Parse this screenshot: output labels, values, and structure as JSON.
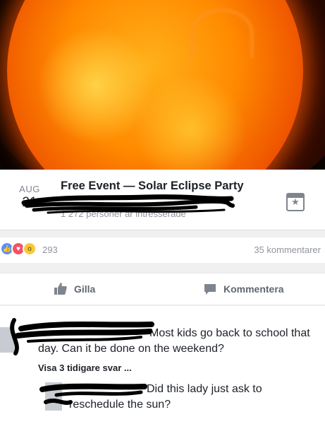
{
  "event": {
    "month": "AUG",
    "day": "21",
    "title": "Free Event — Solar Eclipse Party",
    "subtitle": "1 272 personer är intresserade"
  },
  "stats": {
    "reaction_count": "293",
    "comment_count": "35 kommentarer",
    "reactions": [
      "like-icon",
      "love-icon",
      "wow-icon"
    ]
  },
  "actions": {
    "like_label": "Gilla",
    "comment_label": "Kommentera"
  },
  "comments": {
    "first_text": "Most kids go back to school that day. Can it be done on the weekend?",
    "view_replies": "Visa 3 tidigare svar ...",
    "reply_text": "Did this lady just ask to reschedule the sun?"
  },
  "colors": {
    "like_blue": "#5890ff",
    "love_red": "#f25268",
    "wow_yellow": "#f7c93a",
    "muted_text": "#90949c",
    "sun_orange": "#ff8a00"
  }
}
